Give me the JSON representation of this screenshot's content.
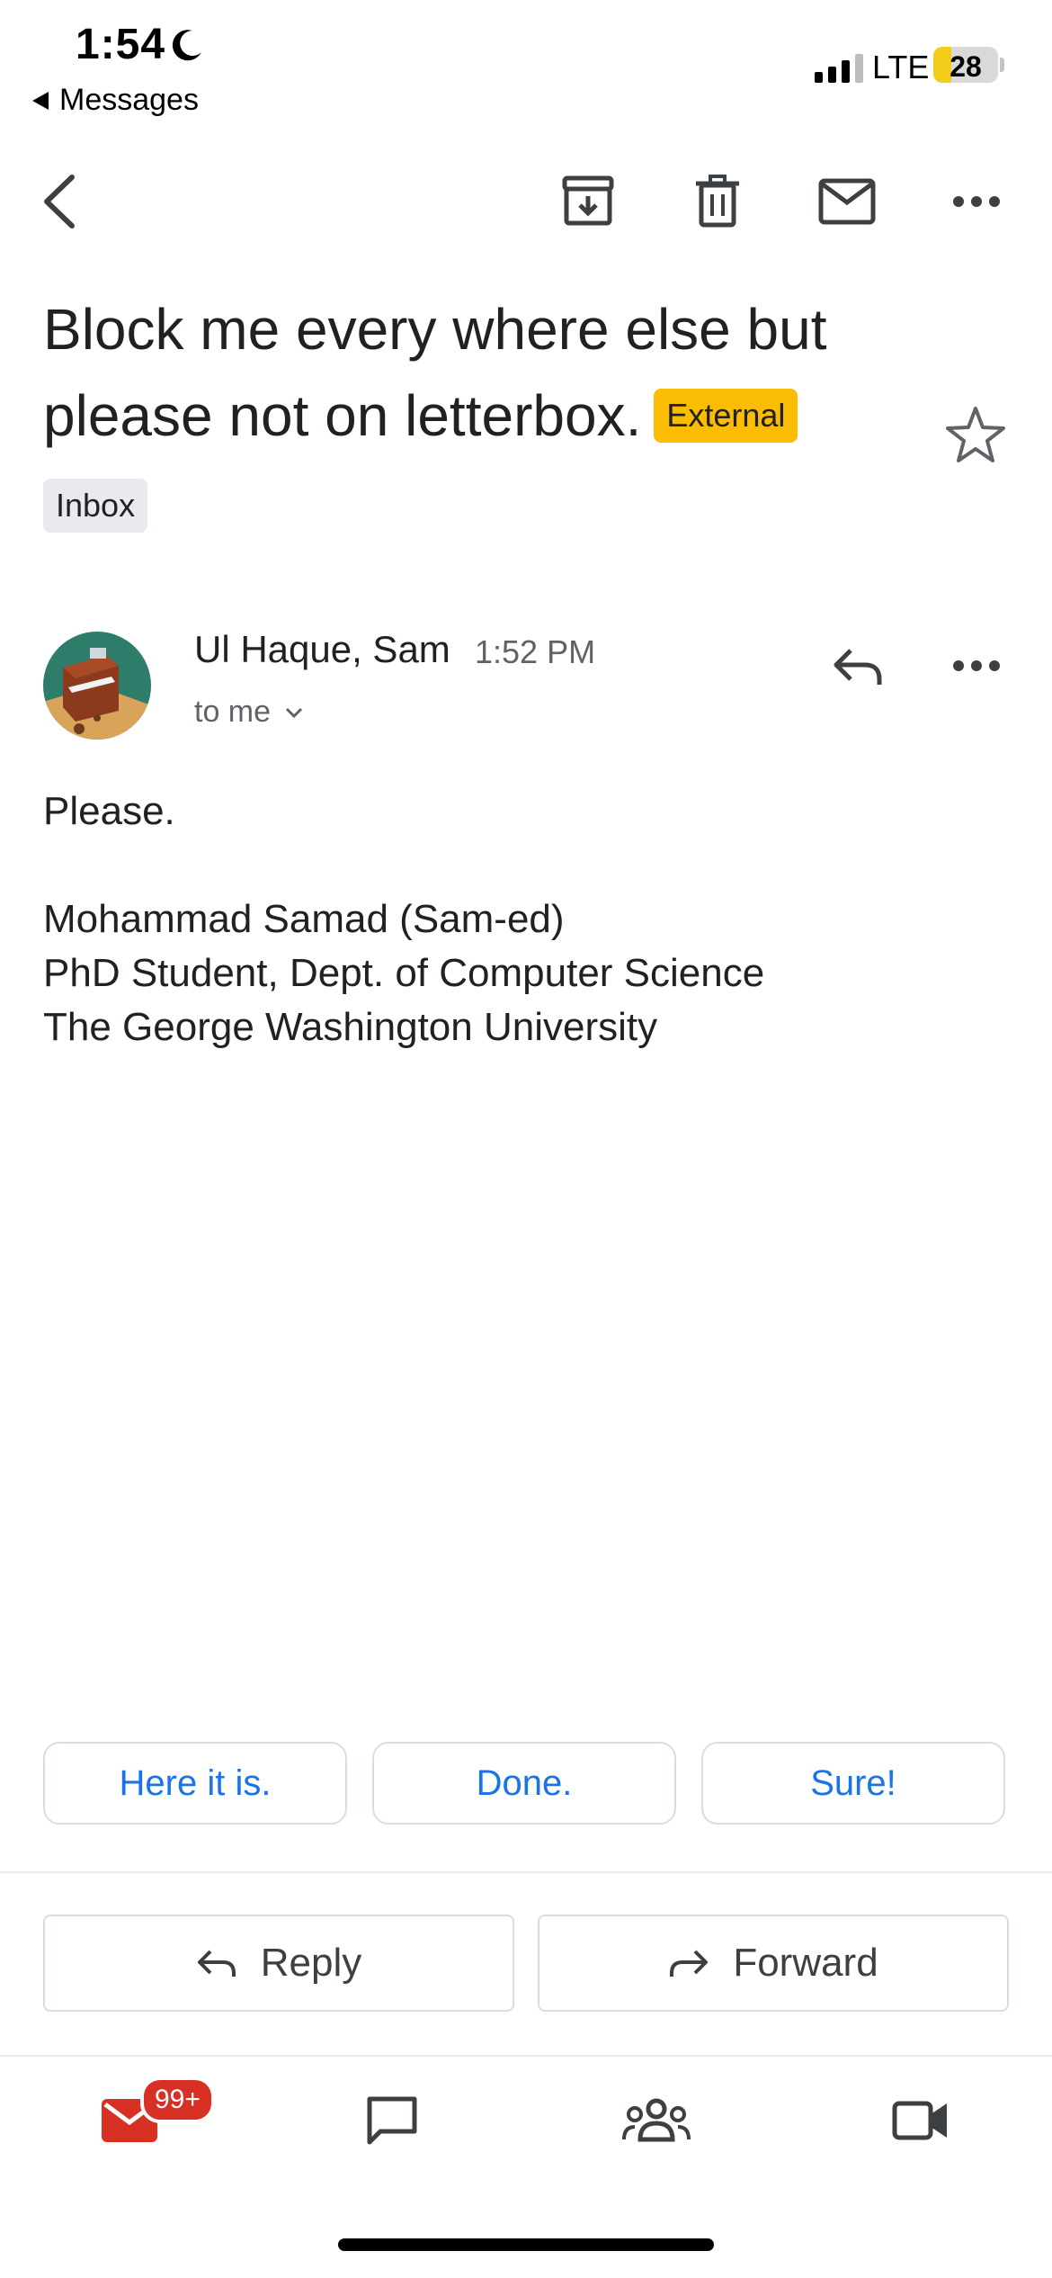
{
  "status_bar": {
    "time": "1:54",
    "back_app_label": "Messages",
    "network": "LTE",
    "battery_percent": 28
  },
  "toolbar": {
    "icons": [
      "back-arrow-icon",
      "archive-icon",
      "trash-icon",
      "mail-icon",
      "more-icon"
    ]
  },
  "email": {
    "subject": "Block me every where else but please not on letterbox.",
    "external_label": "External",
    "folder_label": "Inbox",
    "starred": false,
    "sender": {
      "name": "Ul Haque, Sam",
      "time": "1:52 PM",
      "recipient_label": "to me"
    },
    "body": "Please.",
    "signature": [
      "Mohammad Samad (Sam-ed)",
      "PhD Student, Dept. of Computer Science",
      "The George Washington University"
    ]
  },
  "smart_replies": [
    "Here it is.",
    "Done.",
    "Sure!"
  ],
  "actions": {
    "reply_label": "Reply",
    "forward_label": "Forward"
  },
  "bottom_nav": {
    "mail_badge": "99+",
    "items": [
      "mail-icon",
      "chat-icon",
      "spaces-icon",
      "meet-icon"
    ]
  },
  "colors": {
    "accent_blue": "#1a73e8",
    "external_badge": "#fbbc04",
    "mail_red": "#d93025",
    "battery_yellow": "#f3cc1a"
  }
}
